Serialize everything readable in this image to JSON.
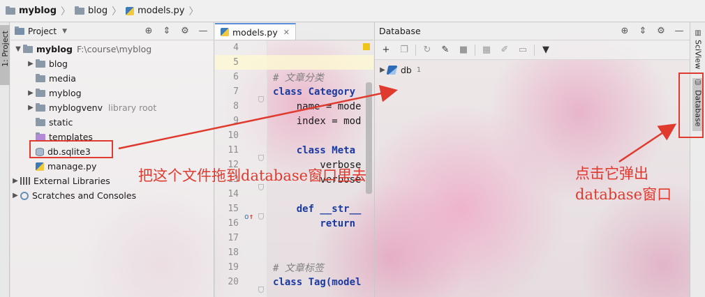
{
  "breadcrumb": {
    "items": [
      {
        "label": "myblog",
        "icon": "folder-icon",
        "bold": true
      },
      {
        "label": "blog",
        "icon": "folder-icon"
      },
      {
        "label": "models.py",
        "icon": "python-file-icon"
      }
    ]
  },
  "left_strip": {
    "tab_label": "1: Project"
  },
  "right_strip": {
    "tabs": [
      {
        "label": "SciView"
      },
      {
        "label": "Database"
      }
    ]
  },
  "project": {
    "title": "Project",
    "tree": [
      {
        "label": "myblog",
        "note": "F:\\course\\myblog",
        "icon": "folder-icon",
        "expanded": true
      },
      {
        "label": "blog",
        "icon": "folder-icon"
      },
      {
        "label": "media",
        "icon": "folder-icon"
      },
      {
        "label": "myblog",
        "icon": "folder-icon"
      },
      {
        "label": "myblogvenv",
        "note": "library root",
        "icon": "folder-icon"
      },
      {
        "label": "static",
        "icon": "folder-icon"
      },
      {
        "label": "templates",
        "icon": "folder-icon",
        "color": "#b28ad8"
      },
      {
        "label": "db.sqlite3",
        "icon": "database-file-icon"
      },
      {
        "label": "manage.py",
        "icon": "python-file-icon"
      },
      {
        "label": "External Libraries",
        "icon": "library-icon"
      },
      {
        "label": "Scratches and Consoles",
        "icon": "scratch-icon"
      }
    ]
  },
  "editor": {
    "tab_label": "models.py",
    "lines": [
      {
        "num": "4",
        "text": ""
      },
      {
        "num": "5",
        "text": ""
      },
      {
        "num": "6",
        "text": "# 文章分类"
      },
      {
        "num": "7",
        "text": "class Category"
      },
      {
        "num": "8",
        "text": "    name = mode"
      },
      {
        "num": "9",
        "text": "    index = mod"
      },
      {
        "num": "10",
        "text": ""
      },
      {
        "num": "11",
        "text": "    class Meta"
      },
      {
        "num": "12",
        "text": "        verbose"
      },
      {
        "num": "13",
        "text": "        verbose"
      },
      {
        "num": "14",
        "text": ""
      },
      {
        "num": "15",
        "text": "    def __str__"
      },
      {
        "num": "16",
        "text": "        return"
      },
      {
        "num": "17",
        "text": ""
      },
      {
        "num": "18",
        "text": ""
      },
      {
        "num": "19",
        "text": "# 文章标签"
      },
      {
        "num": "20",
        "text": "class Tag(model"
      }
    ]
  },
  "database": {
    "title": "Database",
    "tree": [
      {
        "label": "db",
        "badge": "1"
      }
    ]
  },
  "annotations": {
    "drag_hint": "把这个文件拖到database窗口里去",
    "click_hint_line1": "点击它弹出",
    "click_hint_line2": "database窗口"
  },
  "colors": {
    "annotation": "#e03a2f",
    "keyword": "#1b3aa0",
    "comment": "#808080"
  }
}
